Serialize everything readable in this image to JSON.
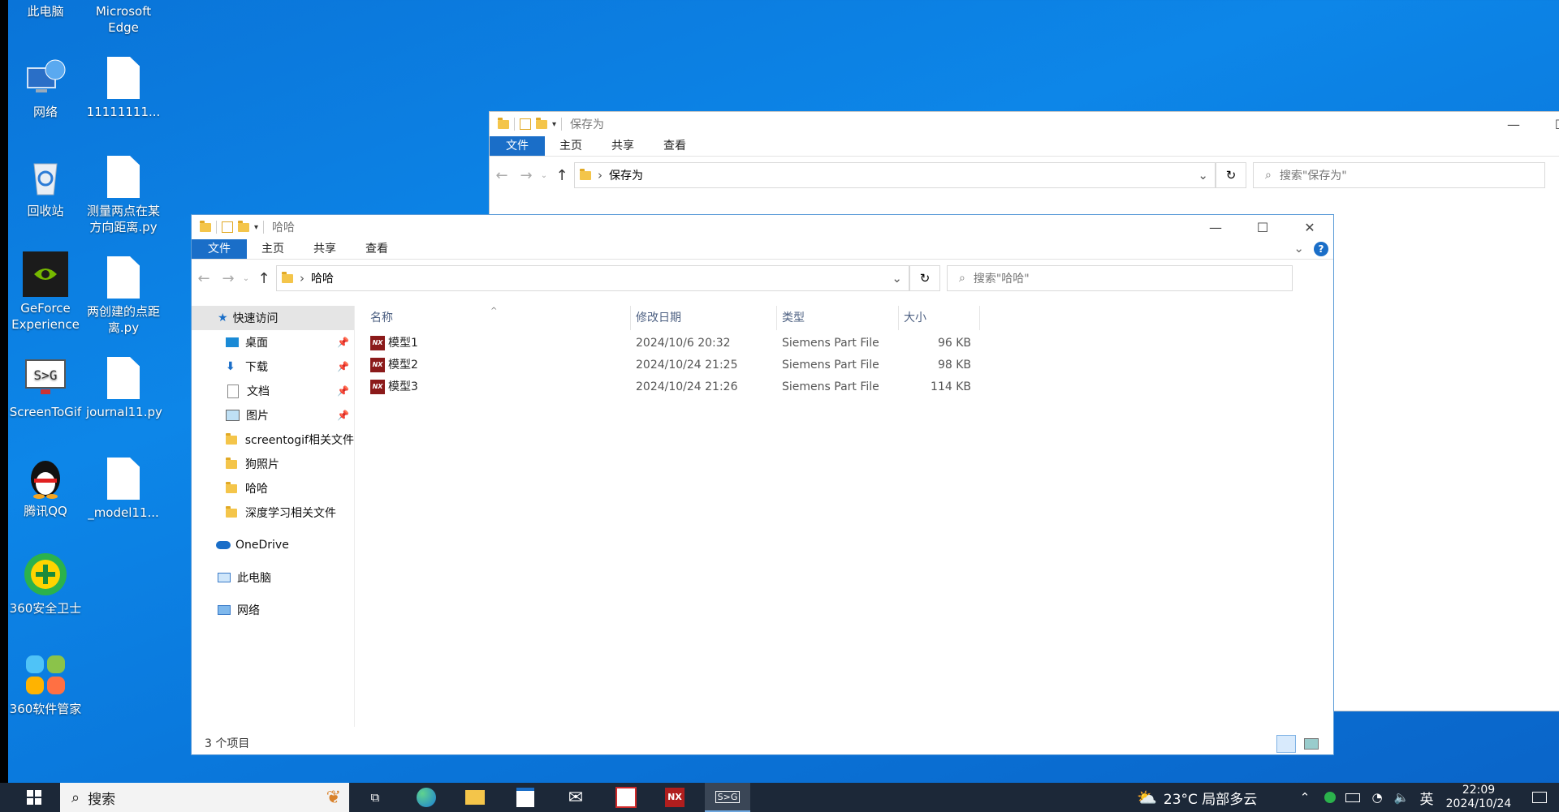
{
  "desktop": {
    "icons": [
      {
        "label": "此电脑"
      },
      {
        "label": "Microsoft Edge"
      },
      {
        "label": "网络"
      },
      {
        "label": "11111111..."
      },
      {
        "label": "回收站"
      },
      {
        "label": "测量两点在某方向距离.py"
      },
      {
        "label": "GeForce Experience"
      },
      {
        "label": "两创建的点距离.py"
      },
      {
        "label": "ScreenToGif"
      },
      {
        "label": "journal11.py"
      },
      {
        "label": "腾讯QQ"
      },
      {
        "label": "_model11..."
      },
      {
        "label": "360安全卫士"
      },
      {
        "label": "360软件管家"
      }
    ]
  },
  "back_window": {
    "title": "保存为",
    "ribbon": {
      "file": "文件",
      "home": "主页",
      "share": "共享",
      "view": "查看"
    },
    "address": "保存为",
    "search_placeholder": "搜索\"保存为\""
  },
  "front_window": {
    "title": "哈哈",
    "ribbon": {
      "file": "文件",
      "home": "主页",
      "share": "共享",
      "view": "查看"
    },
    "address": "哈哈",
    "search_placeholder": "搜索\"哈哈\"",
    "nav": {
      "quick_access": "快速访问",
      "items": [
        {
          "label": "桌面",
          "pinned": true
        },
        {
          "label": "下载",
          "pinned": true
        },
        {
          "label": "文档",
          "pinned": true
        },
        {
          "label": "图片",
          "pinned": true
        },
        {
          "label": "screentogif相关文件",
          "pinned": false
        },
        {
          "label": "狗照片",
          "pinned": false
        },
        {
          "label": "哈哈",
          "pinned": false
        },
        {
          "label": "深度学习相关文件",
          "pinned": false
        }
      ],
      "onedrive": "OneDrive",
      "this_pc": "此电脑",
      "network": "网络"
    },
    "columns": {
      "name": "名称",
      "date": "修改日期",
      "type": "类型",
      "size": "大小"
    },
    "files": [
      {
        "name": "模型1",
        "date": "2024/10/6 20:32",
        "type": "Siemens Part File",
        "size": "96 KB"
      },
      {
        "name": "模型2",
        "date": "2024/10/24 21:25",
        "type": "Siemens Part File",
        "size": "98 KB"
      },
      {
        "name": "模型3",
        "date": "2024/10/24 21:26",
        "type": "Siemens Part File",
        "size": "114 KB"
      }
    ],
    "status": "3 个项目"
  },
  "taskbar": {
    "search_label": "搜索",
    "weather": "23°C 局部多云",
    "ime": "英",
    "time": "22:09",
    "date": "2024/10/24"
  },
  "colors": {
    "accent": "#1a6ec8",
    "taskbar": "#1c2838",
    "folder": "#f4c54a",
    "nx": "#8b1a1a"
  }
}
